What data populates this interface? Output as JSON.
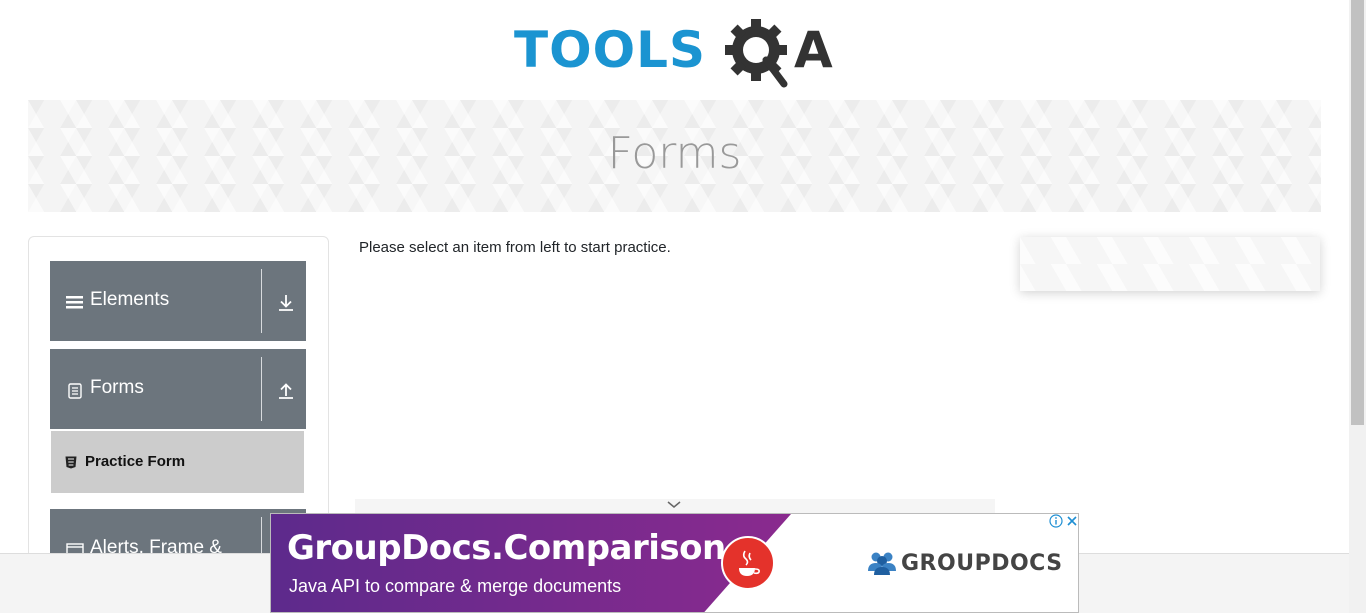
{
  "logo": {
    "text_part": "TOOLS",
    "suffix": "A",
    "colors": {
      "blue": "#1b94d1",
      "dark": "#333333"
    }
  },
  "banner": {
    "title": "Forms"
  },
  "sidebar": {
    "groups": [
      {
        "label": "Elements",
        "icon": "hamburger-icon",
        "toggle_icon": "download-arrow-icon"
      },
      {
        "label": "Forms",
        "icon": "document-icon",
        "toggle_icon": "upload-arrow-icon"
      },
      {
        "label": "Alerts, Frame &",
        "icon": "window-icon"
      }
    ],
    "forms_items": [
      {
        "label": "Practice Form",
        "icon": "html5-icon"
      }
    ]
  },
  "main": {
    "instructions": "Please select an item from left to start practice."
  },
  "ad": {
    "title": "GroupDocs.Comparison",
    "subtitle": "Java API to compare & merge documents",
    "brand": "GROUPDOCS",
    "colors": {
      "purple": "#5d2a8c",
      "java_red": "#e4322b"
    }
  }
}
